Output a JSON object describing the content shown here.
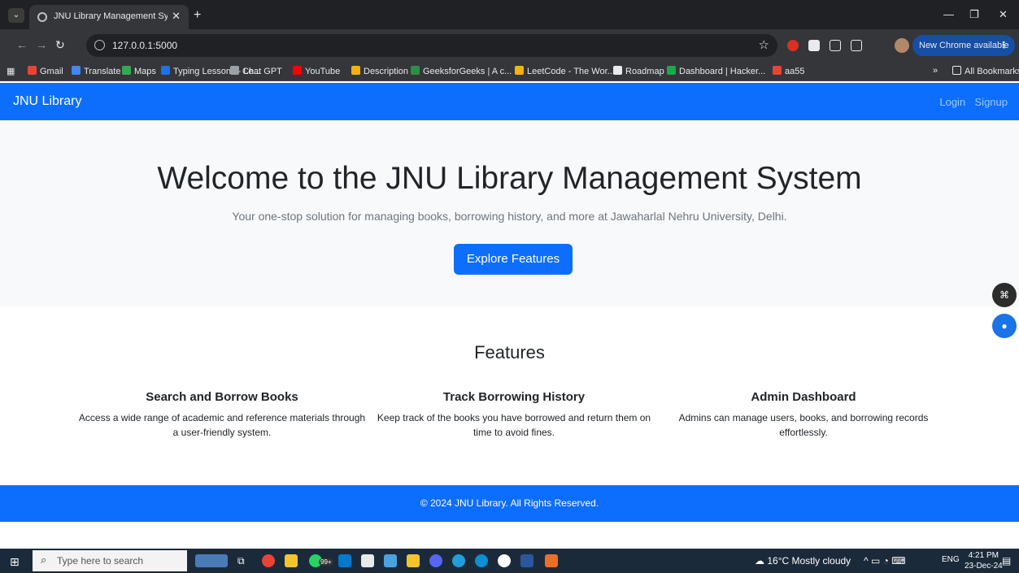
{
  "browser": {
    "tab_title": "JNU Library Management Syste",
    "url": "127.0.0.1:5000",
    "update_label": "New Chrome available",
    "bookmarks": [
      {
        "label": "Gmail",
        "color": "#ea4335"
      },
      {
        "label": "Translate",
        "color": "#4285f4"
      },
      {
        "label": "Maps",
        "color": "#34a853"
      },
      {
        "label": "Typing Lessons - Le...",
        "color": "#1a73e8"
      },
      {
        "label": "Chat GPT",
        "color": "#9aa0a6"
      },
      {
        "label": "YouTube",
        "color": "#ff0000"
      },
      {
        "label": "Description",
        "color": "#f4b400"
      },
      {
        "label": "GeeksforGeeks | A c...",
        "color": "#2f8d46"
      },
      {
        "label": "LeetCode - The Wor...",
        "color": "#f4b400"
      },
      {
        "label": "Roadmap",
        "color": "#e8eaed"
      },
      {
        "label": "Dashboard | Hacker...",
        "color": "#1ba94c"
      },
      {
        "label": "aa55",
        "color": "#ea4335"
      }
    ],
    "all_bookmarks": "All Bookmarks"
  },
  "navbar": {
    "brand": "JNU Library",
    "login": "Login",
    "signup": "Signup"
  },
  "hero": {
    "title": "Welcome to the JNU Library Management System",
    "subtitle": "Your one-stop solution for managing books, borrowing history, and more at Jawaharlal Nehru University, Delhi.",
    "button": "Explore Features"
  },
  "features": {
    "heading": "Features",
    "items": [
      {
        "title": "Search and Borrow Books",
        "desc": "Access a wide range of academic and reference materials through a user-friendly system."
      },
      {
        "title": "Track Borrowing History",
        "desc": "Keep track of the books you have borrowed and return them on time to avoid fines."
      },
      {
        "title": "Admin Dashboard",
        "desc": "Admins can manage users, books, and borrowing records effortlessly."
      }
    ]
  },
  "footer": {
    "text": "© 2024 JNU Library. All Rights Reserved."
  },
  "taskbar": {
    "search_placeholder": "Type here to search",
    "weather": "16°C Mostly cloudy",
    "lang": "ENG",
    "time": "4:21 PM",
    "date": "23-Dec-24",
    "whatsapp_badge": "99+"
  },
  "colors": {
    "primary": "#0d6efd",
    "hero_bg": "#f8f9fa"
  }
}
